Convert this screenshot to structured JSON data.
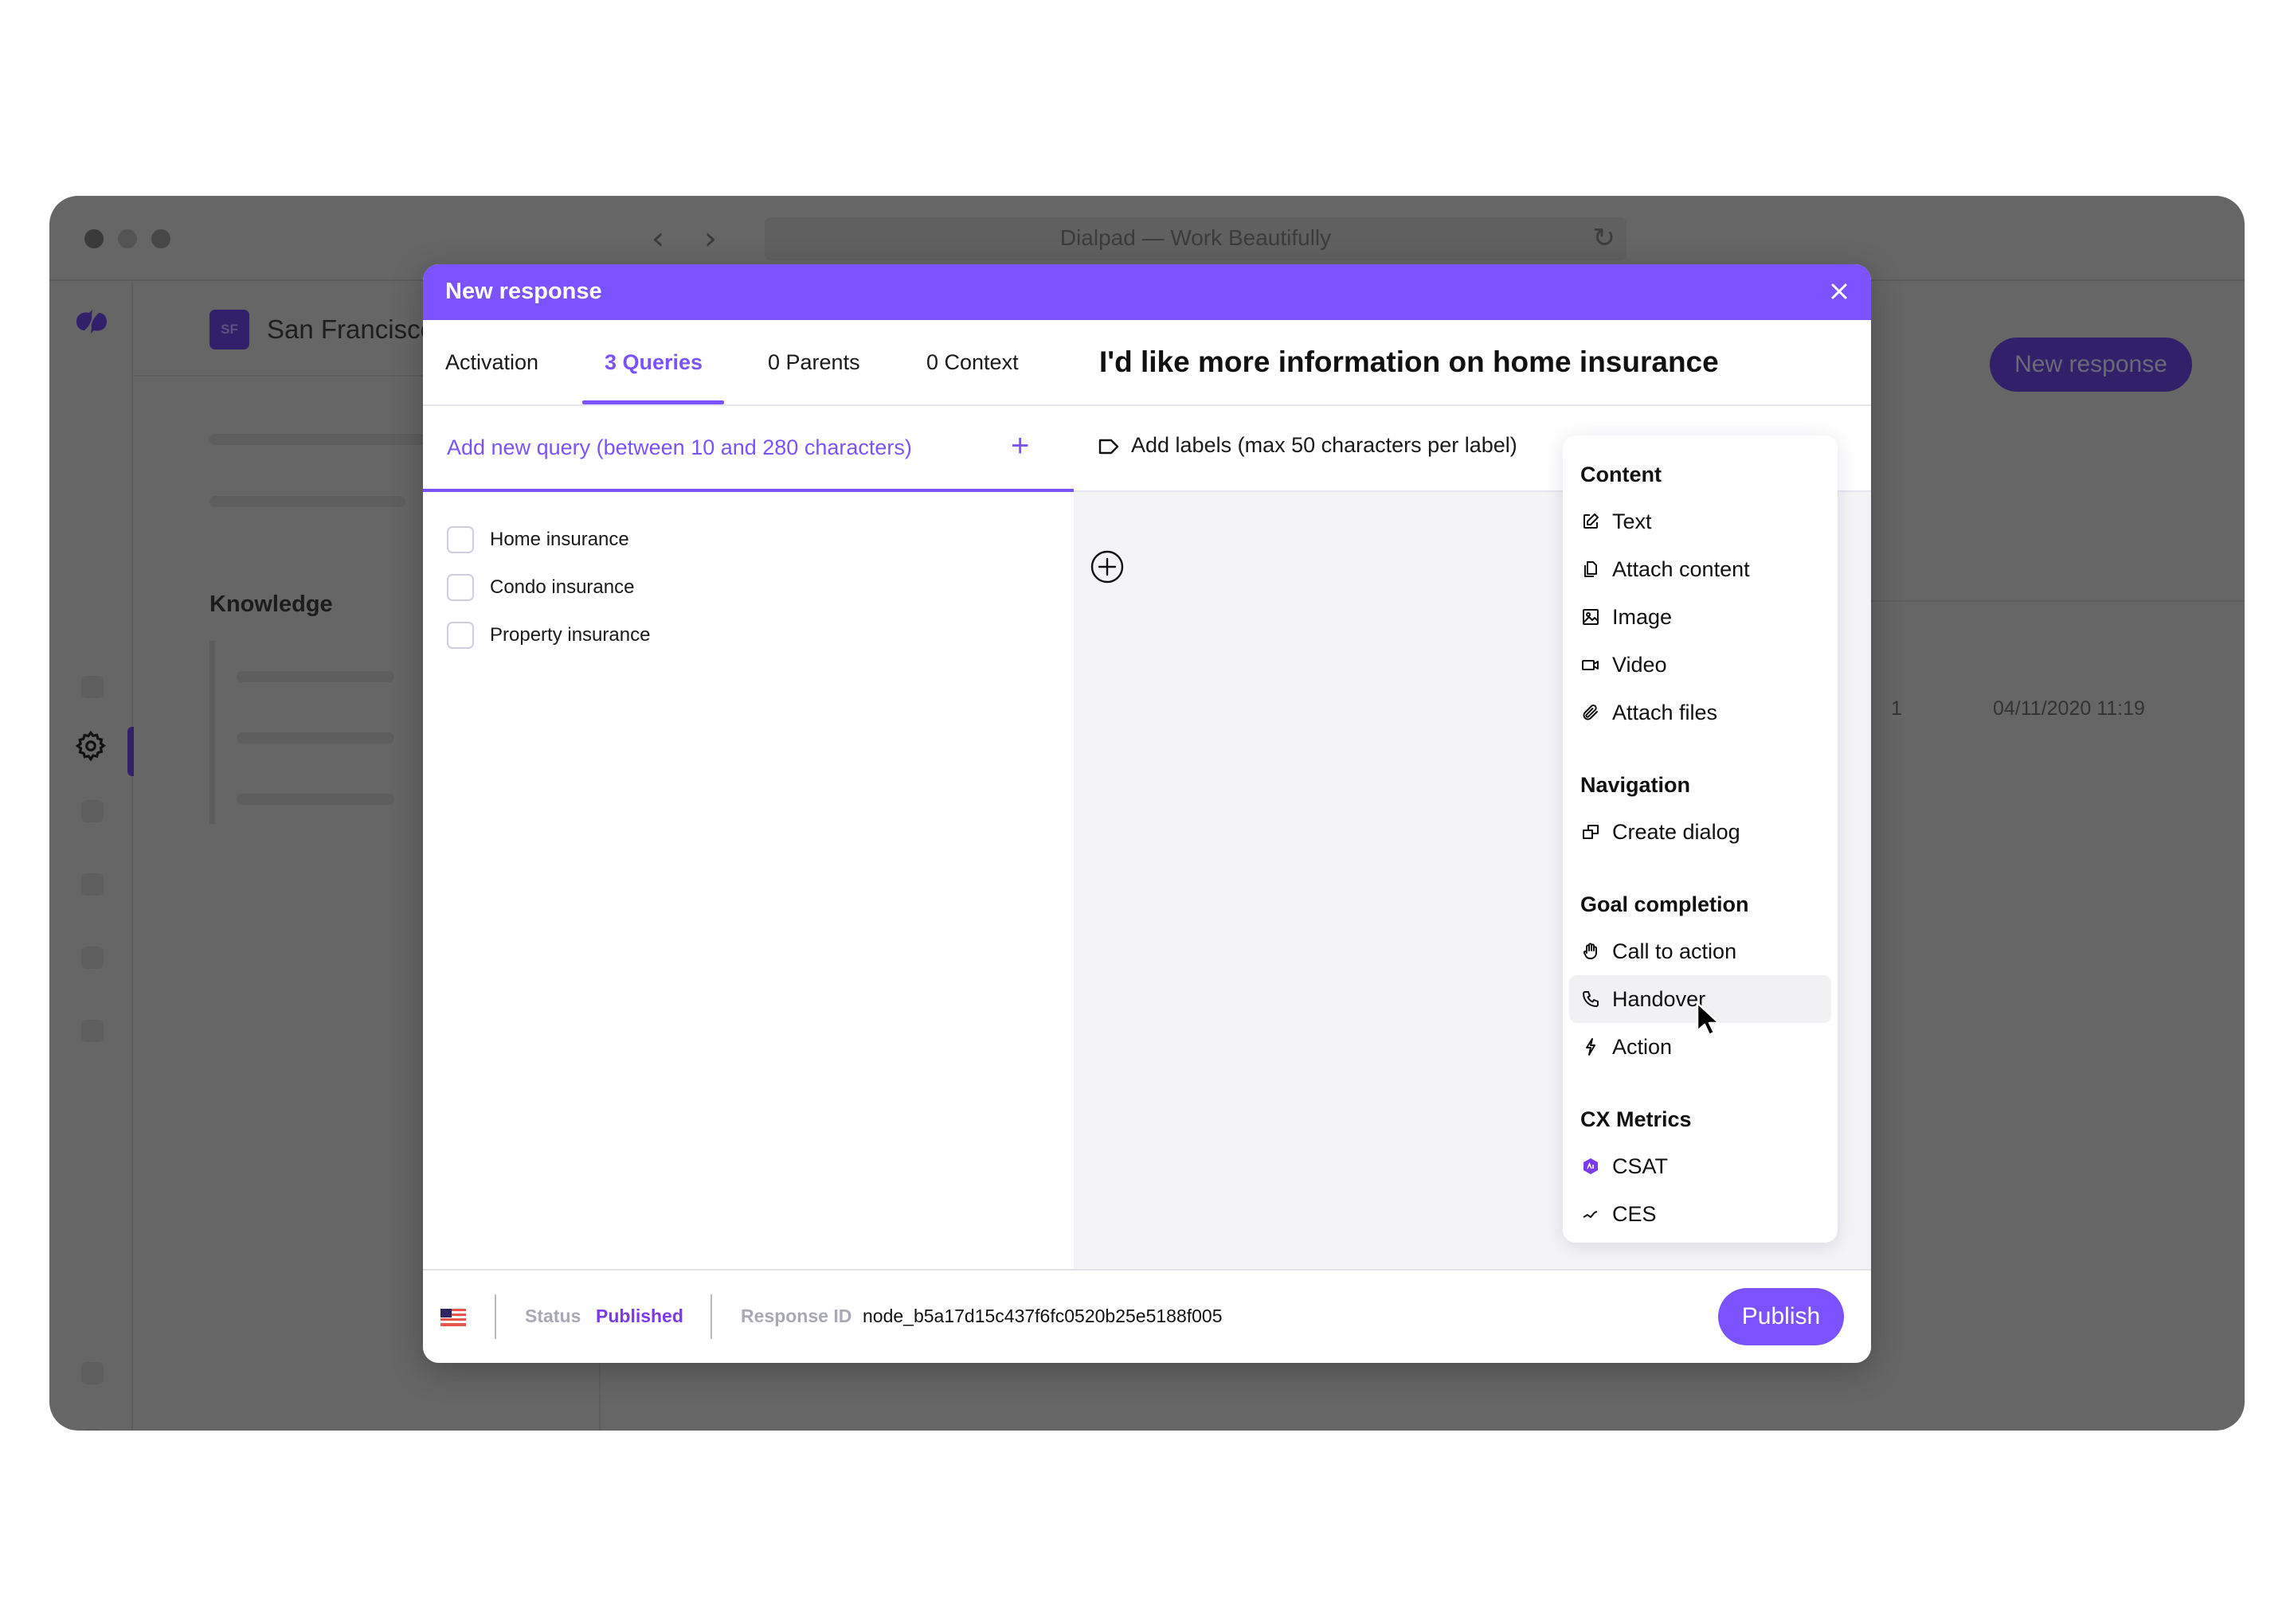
{
  "browser": {
    "title": "Dialpad — Work Beautifully",
    "back_icon": "chevron-left-icon",
    "forward_icon": "chevron-right-icon",
    "reload_icon": "reload-icon"
  },
  "background_app": {
    "org": {
      "initials": "SF",
      "name": "San Francisco"
    },
    "section_title": "Knowledge",
    "new_response_button": "New response",
    "table_row": {
      "count": "1",
      "date": "04/11/2020 11:19"
    },
    "rail_icons": [
      "dialpad-logo-icon",
      "settings-gear-icon"
    ]
  },
  "modal": {
    "title": "New response",
    "close_icon": "close-icon",
    "tabs": [
      {
        "label": "Activation",
        "active": false
      },
      {
        "label": "3 Queries",
        "active": true
      },
      {
        "label": "0 Parents",
        "active": false
      },
      {
        "label": "0 Context",
        "active": false
      }
    ],
    "response_title": "I'd like more information on home insurance",
    "query_input": {
      "placeholder": "Add new query (between 10 and 280 characters)",
      "value": "",
      "add_icon": "plus-icon"
    },
    "queries": [
      {
        "label": "Home insurance",
        "checked": false
      },
      {
        "label": "Condo insurance",
        "checked": false
      },
      {
        "label": "Property insurance",
        "checked": false
      }
    ],
    "labels_placeholder": "Add labels (max 50 characters per label)",
    "add_block_icon": "plus-circle-icon",
    "menu": {
      "sections": [
        {
          "title": "Content",
          "items": [
            {
              "label": "Text",
              "icon": "edit-icon"
            },
            {
              "label": "Attach content",
              "icon": "copy-icon"
            },
            {
              "label": "Image",
              "icon": "image-icon"
            },
            {
              "label": "Video",
              "icon": "video-icon"
            },
            {
              "label": "Attach files",
              "icon": "paperclip-icon"
            }
          ]
        },
        {
          "title": "Navigation",
          "items": [
            {
              "label": "Create dialog",
              "icon": "dialog-icon"
            }
          ]
        },
        {
          "title": "Goal completion",
          "items": [
            {
              "label": "Call to action",
              "icon": "hand-icon"
            },
            {
              "label": "Handover",
              "icon": "phone-icon",
              "hovered": true
            },
            {
              "label": "Action",
              "icon": "lightning-icon"
            }
          ]
        },
        {
          "title": "CX Metrics",
          "items": [
            {
              "label": "CSAT",
              "icon": "csat-badge-icon"
            },
            {
              "label": "CES",
              "icon": "trend-icon"
            }
          ]
        }
      ]
    },
    "footer": {
      "language_flag": "us-flag-icon",
      "status_label": "Status",
      "status_value": "Published",
      "response_id_label": "Response ID",
      "response_id_value": "node_b5a17d15c437f6fc0520b25e5188f005",
      "publish_button": "Publish"
    }
  },
  "colors": {
    "accent": "#7c52ff",
    "status_published": "#7c3aed",
    "overlay_bg": "#666666",
    "dark_brand": "#32206a"
  }
}
